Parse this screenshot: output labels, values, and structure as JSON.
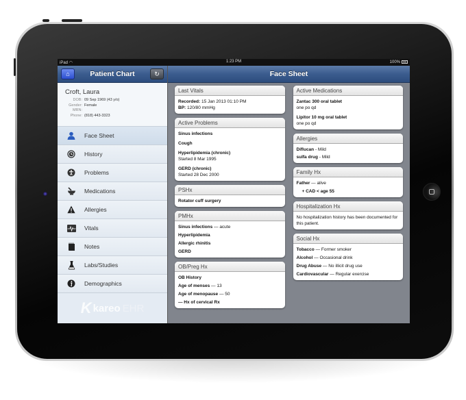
{
  "status_bar": {
    "device": "iPad",
    "time": "1:23 PM",
    "battery": "100%"
  },
  "sidebar": {
    "title": "Patient Chart",
    "home_button": "home-icon",
    "refresh_button": "refresh-icon",
    "patient": {
      "name": "Croft, Laura",
      "fields": [
        {
          "label": "DOB:",
          "value": "09 Sep 1969 (43 y/o)"
        },
        {
          "label": "Gender:",
          "value": "Female"
        },
        {
          "label": "MRN:",
          "value": ""
        },
        {
          "label": "Phone:",
          "value": "(818) 443-3323"
        }
      ]
    },
    "items": [
      {
        "label": "Face Sheet",
        "icon": "person-icon",
        "glyph": "👤",
        "active": true
      },
      {
        "label": "History",
        "icon": "clock-icon",
        "glyph": "◔"
      },
      {
        "label": "Problems",
        "icon": "accessibility-icon",
        "glyph": "✪"
      },
      {
        "label": "Medications",
        "icon": "mortar-pestle-icon",
        "glyph": "⌓"
      },
      {
        "label": "Allergies",
        "icon": "warning-icon",
        "glyph": "▲"
      },
      {
        "label": "Vitals",
        "icon": "heartbeat-icon",
        "glyph": "⌁"
      },
      {
        "label": "Notes",
        "icon": "notepad-icon",
        "glyph": "▮"
      },
      {
        "label": "Labs/Studies",
        "icon": "flask-icon",
        "glyph": "⚗"
      },
      {
        "label": "Demographics",
        "icon": "info-icon",
        "glyph": "ℹ"
      }
    ],
    "logo": {
      "k": "K",
      "brand": "kareo",
      "suffix": "EHR"
    }
  },
  "main": {
    "title": "Face Sheet",
    "last_vitals": {
      "title": "Last Vitals",
      "recorded_label": "Recorded:",
      "recorded_value": "15 Jan 2013 01:10 PM",
      "bp_label": "BP:",
      "bp_value": "120/80 mmHg"
    },
    "active_problems": {
      "title": "Active Problems",
      "items": [
        {
          "name": "Sinus infections",
          "detail": ""
        },
        {
          "name": "Cough",
          "detail": ""
        },
        {
          "name": "Hyperlipidemia (chronic)",
          "detail": "Started 8 Mar 1995"
        },
        {
          "name": "GERD (chronic)",
          "detail": "Started 28 Dec 2000"
        }
      ]
    },
    "pshx": {
      "title": "PSHx",
      "items": [
        "Rotator cuff surgery"
      ]
    },
    "pmhx": {
      "title": "PMHx",
      "items": [
        {
          "name": "Sinus infections",
          "detail": " — acute"
        },
        {
          "name": "Hyperlipidemia",
          "detail": ""
        },
        {
          "name": "Allergic rhinitis",
          "detail": ""
        },
        {
          "name": "GERD",
          "detail": ""
        }
      ]
    },
    "ob_preg": {
      "title": "OB/Preg Hx",
      "items": [
        {
          "name": "OB History",
          "detail": ""
        },
        {
          "name": "Age of menses",
          "detail": " — 13"
        },
        {
          "name": "Age of menopause",
          "detail": " — 50"
        },
        {
          "name": "— Hx of cervical Rx",
          "detail": ""
        }
      ]
    },
    "active_medications": {
      "title": "Active Medications",
      "items": [
        {
          "name": "Zantac 300 oral tablet",
          "detail": "one po qd"
        },
        {
          "name": "Lipitor 10 mg oral tablet",
          "detail": "one po qd"
        }
      ]
    },
    "allergies": {
      "title": "Allergies",
      "items": [
        {
          "name": "Diflucan",
          "detail": " - Mild"
        },
        {
          "name": "sulfa drug",
          "detail": " - Mild"
        }
      ]
    },
    "family_hx": {
      "title": "Family Hx",
      "relation": "Father",
      "relation_detail": " — alive",
      "condition": "+ CAD < age 55"
    },
    "hospitalization_hx": {
      "title": "Hospitalization Hx",
      "text": "No hospitalization history has been documented for this patient."
    },
    "social_hx": {
      "title": "Social Hx",
      "items": [
        {
          "name": "Tobacco",
          "detail": " — Former smoker"
        },
        {
          "name": "Alcohol",
          "detail": " — Occasional drink"
        },
        {
          "name": "Drug Abuse",
          "detail": " — No illicit drug use"
        },
        {
          "name": "Cardiovascular",
          "detail": " — Regular exercise"
        }
      ]
    }
  }
}
